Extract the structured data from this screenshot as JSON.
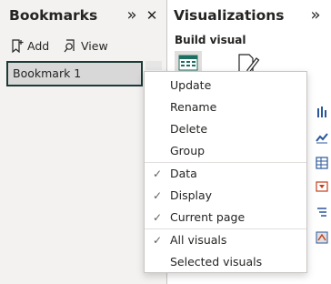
{
  "bookmarks_pane": {
    "title": "Bookmarks",
    "collapse_glyph": "»",
    "close_glyph": "✕",
    "add_label": "Add",
    "view_label": "View",
    "items": [
      {
        "label": "Bookmark 1"
      }
    ]
  },
  "visualizations_pane": {
    "title": "Visualizations",
    "collapse_glyph": "»",
    "build_visual_label": "Build visual"
  },
  "context_menu": {
    "check_glyph": "✓",
    "group1": [
      {
        "label": "Update"
      },
      {
        "label": "Rename"
      },
      {
        "label": "Delete"
      },
      {
        "label": "Group"
      }
    ],
    "group2": [
      {
        "label": "Data",
        "checked": true
      },
      {
        "label": "Display",
        "checked": true
      },
      {
        "label": "Current page",
        "checked": true
      }
    ],
    "group3": [
      {
        "label": "All visuals",
        "checked": true
      },
      {
        "label": "Selected visuals",
        "checked": false
      }
    ]
  },
  "colors": {
    "selected_border": "#1d3a35",
    "selected_fill": "#d8d8d8",
    "pane_background": "#f3f2f1",
    "icon_blue": "#2b579a",
    "icon_teal": "#1d6e62"
  },
  "icons": [
    "add-bookmark-icon",
    "view-icon",
    "table-visual-icon",
    "format-visual-icon"
  ]
}
